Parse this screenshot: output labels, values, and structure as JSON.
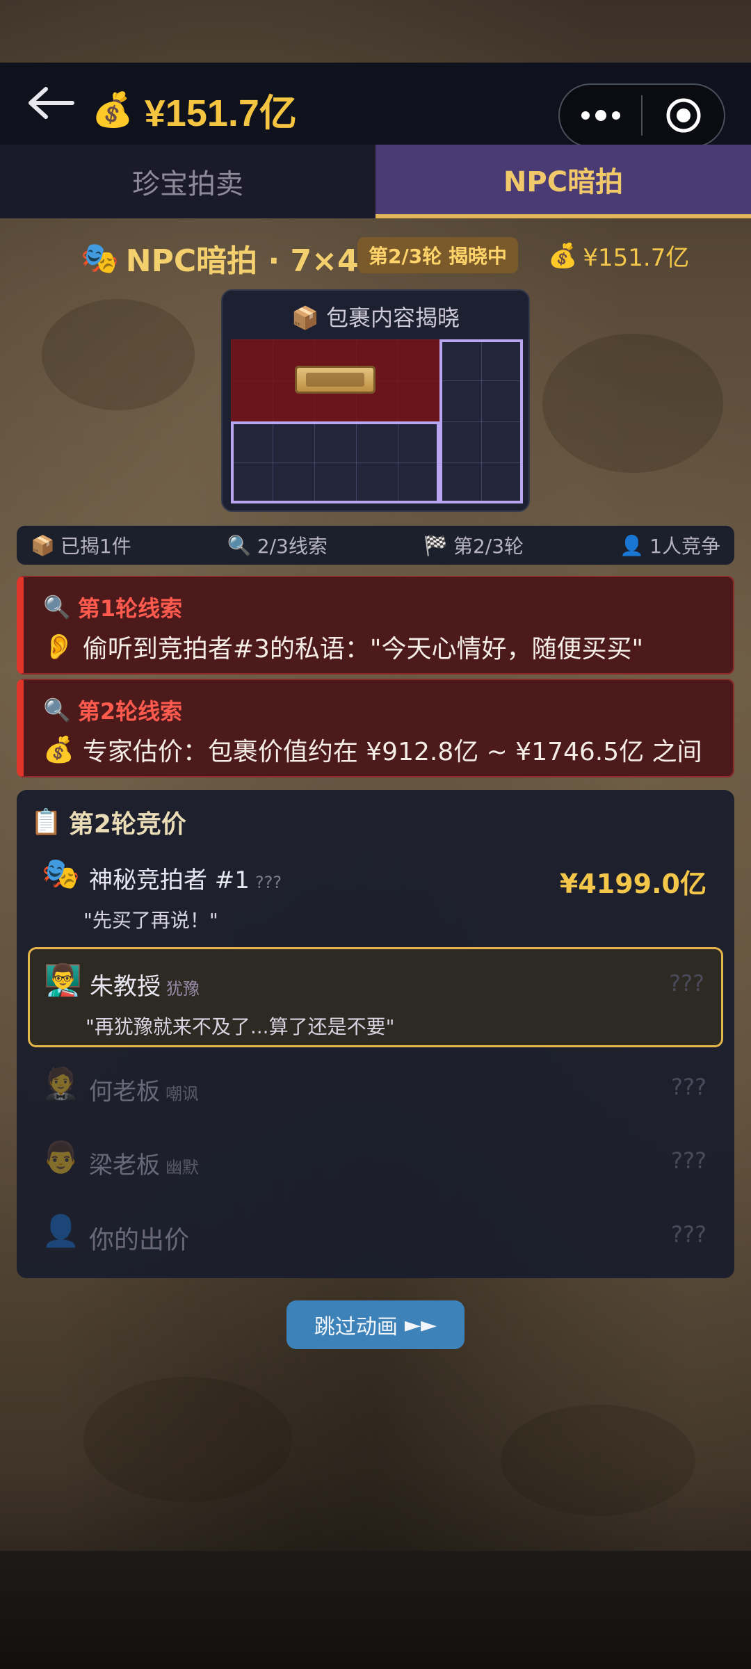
{
  "topbar": {
    "back_icon": "back-arrow-icon",
    "money_icon": "money-bag-icon",
    "money": "¥151.7亿",
    "capsule": {
      "more_icon": "more-dots-icon",
      "target_icon": "record-target-icon"
    }
  },
  "tabs": [
    {
      "label": "珍宝拍卖",
      "active": false
    },
    {
      "label": "NPC暗拍",
      "active": true
    }
  ],
  "header": {
    "icon": "theater-masks-icon",
    "title": "NPC暗拍 · 7×4",
    "round_badge": "第2/3轮 揭晓中",
    "money_icon": "money-bag-icon",
    "money": "¥151.7亿"
  },
  "package": {
    "title_icon": "package-icon",
    "title": "包裹内容揭晓",
    "grid_cols": 7,
    "grid_rows": 4
  },
  "stats": {
    "revealed": "已揭1件",
    "clues": "2/3线索",
    "round": "第2/3轮",
    "competitors": "1人竞争"
  },
  "clues": [
    {
      "title": "第1轮线索",
      "icon": "ear-icon",
      "text": "偷听到竞拍者#3的私语：\"今天心情好，随便买买\""
    },
    {
      "title": "第2轮线索",
      "icon": "money-bag-icon",
      "text": "专家估价：包裹价值约在 ¥912.8亿 ~ ¥1746.5亿 之间"
    }
  ],
  "bidding": {
    "title": "第2轮竞价",
    "rows": [
      {
        "name": "神秘竞拍者 #1",
        "tag": "???",
        "price": "¥4199.0亿",
        "quote": "\"先买了再说！\"",
        "icon": "theater-masks-icon"
      },
      {
        "name": "朱教授",
        "tag": "犹豫",
        "price": "???",
        "quote": "\"再犹豫就来不及了...算了还是不要\"",
        "icon": "professor-avatar-icon"
      },
      {
        "name": "何老板",
        "tag": "嘲讽",
        "price": "???",
        "icon": "boss-avatar-icon"
      },
      {
        "name": "梁老板",
        "tag": "幽默",
        "price": "???",
        "icon": "boss-avatar-icon"
      },
      {
        "name": "你的出价",
        "price": "???",
        "icon": "user-silhouette-icon"
      }
    ]
  },
  "skip": {
    "label": "跳过动画",
    "icon": "fast-forward-icon"
  },
  "colors": {
    "gold": "#f4c64a",
    "tab_active": "#4a3b74",
    "clue_red": "#e0352b",
    "highlight": "#e6b54a"
  }
}
